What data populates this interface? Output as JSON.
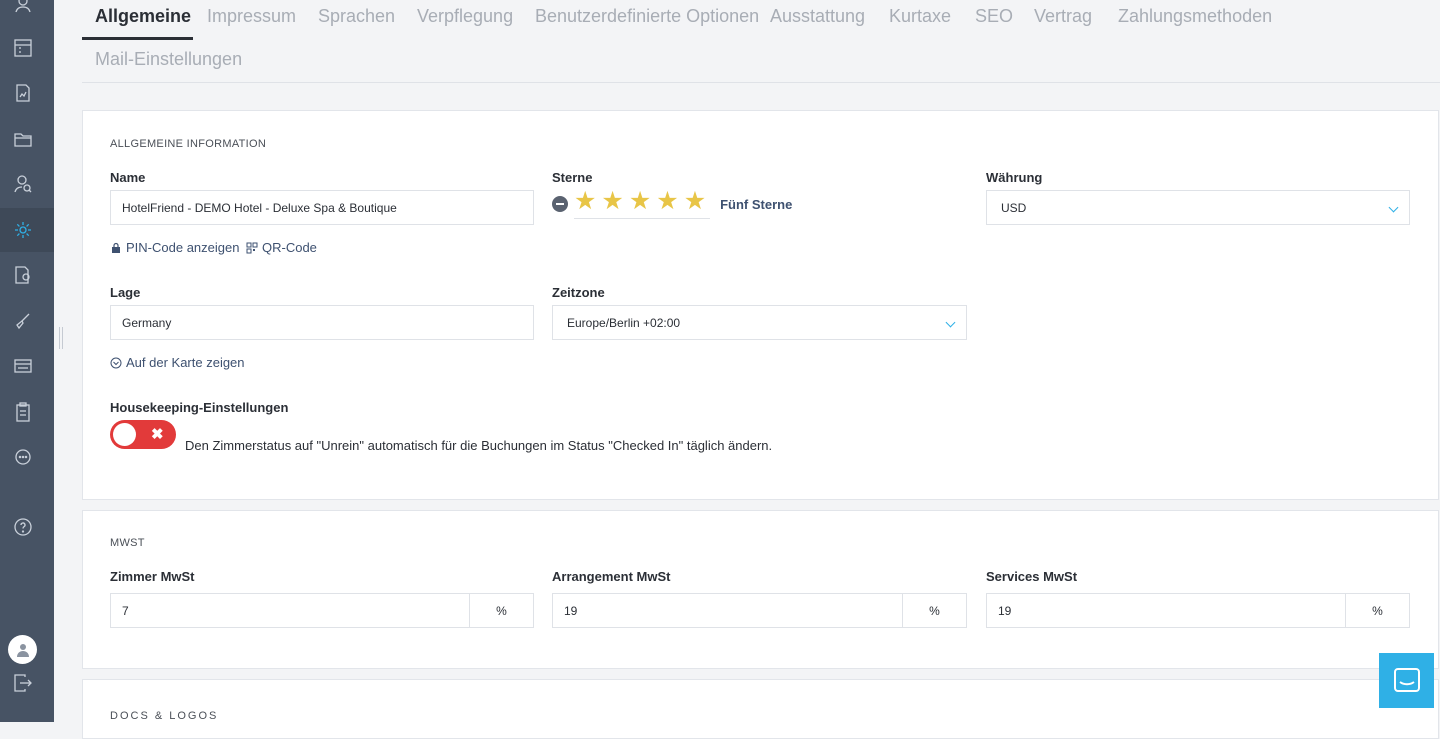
{
  "tabs": [
    {
      "label": "Allgemeine",
      "active": true
    },
    {
      "label": "Impressum"
    },
    {
      "label": "Sprachen"
    },
    {
      "label": "Verpflegung"
    },
    {
      "label": "Benutzerdefinierte Optionen"
    },
    {
      "label": "Ausstattung"
    },
    {
      "label": "Kurtaxe"
    },
    {
      "label": "SEO"
    },
    {
      "label": "Vertrag"
    },
    {
      "label": "Zahlungsmethoden"
    },
    {
      "label": "Mail-Einstellungen"
    }
  ],
  "general": {
    "section_title": "ALLGEMEINE INFORMATION",
    "name_label": "Name",
    "name_value": "HotelFriend - DEMO Hotel - Deluxe Spa & Boutique",
    "stars_label": "Sterne",
    "stars_rating": 5,
    "stars_text": "Fünf Sterne",
    "currency_label": "Währung",
    "currency_value": "USD",
    "pin_link": "PIN-Code anzeigen",
    "qr_link": "QR-Code",
    "location_label": "Lage",
    "location_value": "Germany",
    "timezone_label": "Zeitzone",
    "timezone_value": "Europe/Berlin +02:00",
    "map_link": "Auf der Karte zeigen",
    "housekeeping_label": "Housekeeping-Einstellungen",
    "housekeeping_toggle_on": false,
    "housekeeping_text": "Den Zimmerstatus auf \"Unrein\" automatisch für die Buchungen im Status \"Checked In\" täglich ändern."
  },
  "vat": {
    "section_title": "MWST",
    "room_label": "Zimmer MwSt",
    "room_value": "7",
    "arrangement_label": "Arrangement MwSt",
    "arrangement_value": "19",
    "services_label": "Services MwSt",
    "services_value": "19",
    "unit": "%"
  },
  "docs": {
    "section_title": "DOCS & LOGOS"
  },
  "colors": {
    "accent": "#2fb0e6",
    "sidebar": "#475364",
    "star": "#e8c547",
    "toggle_off": "#e23a3a"
  }
}
